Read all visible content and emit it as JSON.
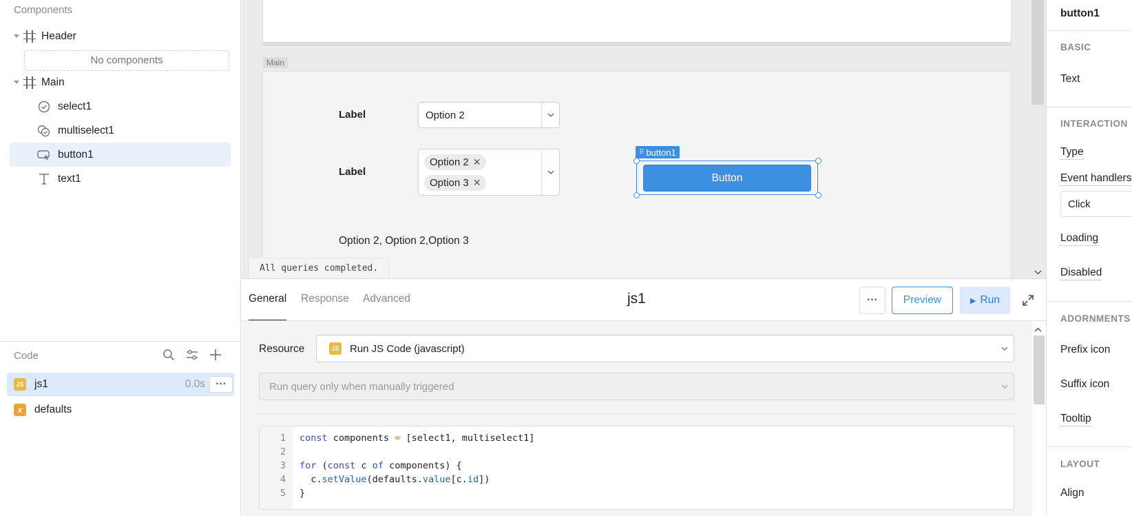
{
  "left_panel": {
    "components_title": "Components",
    "header_label": "Header",
    "no_components": "No components",
    "main_label": "Main",
    "items": [
      {
        "label": "select1",
        "icon": "select-icon"
      },
      {
        "label": "multiselect1",
        "icon": "multiselect-icon"
      },
      {
        "label": "button1",
        "icon": "button-icon"
      },
      {
        "label": "text1",
        "icon": "text-icon"
      }
    ],
    "code_title": "Code",
    "queries": [
      {
        "label": "js1",
        "badge": "JS",
        "time": "0.0s"
      },
      {
        "label": "defaults",
        "badge": "x"
      }
    ]
  },
  "canvas": {
    "main_tag": "Main",
    "select_label": "Label",
    "select_value": "Option 2",
    "multiselect_label": "Label",
    "chips": [
      "Option 2",
      "Option 3"
    ],
    "button_tag": "button1",
    "button_label": "Button",
    "text_value": "Option 2, Option 2,Option 3",
    "status": "All queries completed."
  },
  "query_panel": {
    "tabs": [
      "General",
      "Response",
      "Advanced"
    ],
    "title": "js1",
    "more_label": "···",
    "preview_label": "Preview",
    "run_label": "Run",
    "resource_label": "Resource",
    "resource_value": "Run JS Code (javascript)",
    "trigger_value": "Run query only when manually triggered",
    "code_lines": [
      "1",
      "2",
      "3",
      "4",
      "5"
    ]
  },
  "right_panel": {
    "title": "button1",
    "basic": "BASIC",
    "text": "Text",
    "interaction": "INTERACTION",
    "type": "Type",
    "event_handlers": "Event handlers",
    "click": "Click",
    "loading": "Loading",
    "disabled": "Disabled",
    "adornments": "ADORNMENTS",
    "prefix_icon": "Prefix icon",
    "suffix_icon": "Suffix icon",
    "tooltip": "Tooltip",
    "layout": "LAYOUT",
    "align": "Align"
  },
  "colors": {
    "accent": "#3d8fe0",
    "selection": "#e8f1fc",
    "js_badge": "#e9b949"
  }
}
